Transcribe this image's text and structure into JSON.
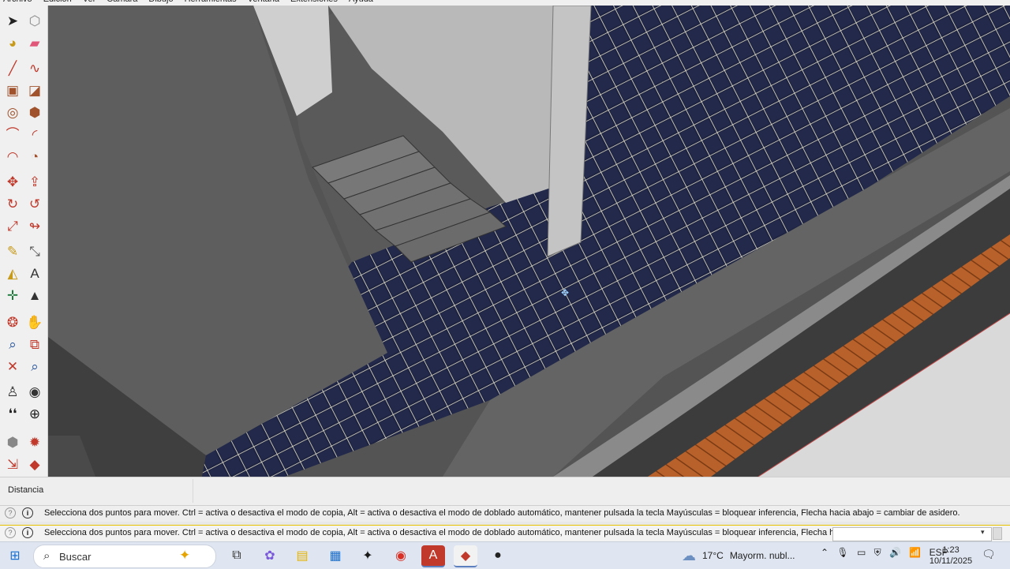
{
  "menubar": {
    "items": [
      "Archivo",
      "Edición",
      "Ver",
      "Cámara",
      "Dibujo",
      "Herramientas",
      "Ventana",
      "Extensiones",
      "Ayuda"
    ]
  },
  "toolbar": {
    "tools": [
      {
        "name": "select-tool-icon",
        "glyph": "➤",
        "color": "#222222"
      },
      {
        "name": "make-component-icon",
        "glyph": "⬡",
        "color": "#888888"
      },
      {
        "name": "paint-bucket-icon",
        "glyph": "◕",
        "color": "#c79a1a"
      },
      {
        "name": "eraser-icon",
        "glyph": "▰",
        "color": "#e0577a"
      },
      {
        "name": "line-tool-icon",
        "glyph": "╱",
        "color": "#c0392b"
      },
      {
        "name": "freehand-tool-icon",
        "glyph": "∿",
        "color": "#c0392b"
      },
      {
        "name": "rectangle-tool-icon",
        "glyph": "▣",
        "color": "#a0522d"
      },
      {
        "name": "rotated-rectangle-icon",
        "glyph": "◪",
        "color": "#a0522d"
      },
      {
        "name": "circle-tool-icon",
        "glyph": "◎",
        "color": "#a0522d"
      },
      {
        "name": "polygon-tool-icon",
        "glyph": "⬢",
        "color": "#a0522d"
      },
      {
        "name": "arc-tool-icon",
        "glyph": "⌒",
        "color": "#c0392b"
      },
      {
        "name": "two-point-arc-icon",
        "glyph": "◜",
        "color": "#c0392b"
      },
      {
        "name": "three-point-arc-icon",
        "glyph": "◠",
        "color": "#c0392b"
      },
      {
        "name": "pie-tool-icon",
        "glyph": "◔",
        "color": "#a0522d"
      },
      {
        "name": "move-tool-icon",
        "glyph": "✥",
        "color": "#c0392b"
      },
      {
        "name": "push-pull-icon",
        "glyph": "⇪",
        "color": "#c0392b"
      },
      {
        "name": "rotate-tool-icon",
        "glyph": "↻",
        "color": "#c0392b"
      },
      {
        "name": "follow-me-icon",
        "glyph": "↺",
        "color": "#c0392b"
      },
      {
        "name": "scale-tool-icon",
        "glyph": "⤢",
        "color": "#c0392b"
      },
      {
        "name": "offset-tool-icon",
        "glyph": "↬",
        "color": "#c0392b"
      },
      {
        "name": "tape-measure-icon",
        "glyph": "✎",
        "color": "#c79a1a"
      },
      {
        "name": "dimension-tool-icon",
        "glyph": "⤡",
        "color": "#555555"
      },
      {
        "name": "protractor-icon",
        "glyph": "◭",
        "color": "#c79a1a"
      },
      {
        "name": "text-tool-icon",
        "glyph": "A",
        "color": "#333333"
      },
      {
        "name": "axes-tool-icon",
        "glyph": "✛",
        "color": "#1a7a3a"
      },
      {
        "name": "3d-text-icon",
        "glyph": "▲",
        "color": "#333333"
      },
      {
        "name": "orbit-tool-icon",
        "glyph": "❂",
        "color": "#c0392b"
      },
      {
        "name": "pan-tool-icon",
        "glyph": "✋",
        "color": "#c79a1a"
      },
      {
        "name": "zoom-tool-icon",
        "glyph": "⌕",
        "color": "#1f4f9a"
      },
      {
        "name": "zoom-window-icon",
        "glyph": "⧉",
        "color": "#c0392b"
      },
      {
        "name": "zoom-extents-icon",
        "glyph": "✕",
        "color": "#c0392b"
      },
      {
        "name": "zoom-previous-icon",
        "glyph": "⌕",
        "color": "#1f4f9a"
      },
      {
        "name": "position-camera-icon",
        "glyph": "♙",
        "color": "#333333"
      },
      {
        "name": "look-around-icon",
        "glyph": "◉",
        "color": "#333333"
      },
      {
        "name": "walk-tool-icon",
        "glyph": "❛❛",
        "color": "#222222"
      },
      {
        "name": "section-plane-icon",
        "glyph": "⊕",
        "color": "#222222"
      },
      {
        "name": "warehouse-icon",
        "glyph": "⬢",
        "color": "#888888"
      },
      {
        "name": "extension-warehouse-icon",
        "glyph": "✹",
        "color": "#c0392b"
      },
      {
        "name": "send-to-layout-icon",
        "glyph": "⇲",
        "color": "#c0392b"
      },
      {
        "name": "ruby-console-icon",
        "glyph": "◆",
        "color": "#c0392b"
      }
    ]
  },
  "measurements": {
    "label": "Distancia",
    "value": ""
  },
  "status": {
    "top_message": "Selecciona dos puntos para mover. Ctrl = activa o desactiva el modo de copia, Alt = activa o desactiva el modo de doblado automático, mantener pulsada la tecla Mayúsculas = bloquear inferencia, Flecha hacia abajo = cambiar de asidero.",
    "bottom_message": "Selecciona dos puntos para mover. Ctrl = activa o desactiva el modo de copia, Alt = activa o desactiva el modo de doblado automático, mantener pulsada la tecla Mayúsculas = bloquear inferencia, Flecha hacia abajo =",
    "help_glyph": "?",
    "info_glyph": "i",
    "vcb_value": ""
  },
  "taskbar": {
    "search_placeholder": "Buscar",
    "weather_temp": "17°C",
    "weather_text": "Mayorm. nubl...",
    "language": "ESP",
    "time": "1:23",
    "date": "10/11/2025",
    "apps": [
      {
        "name": "windows-start-icon",
        "glyph": "⊞",
        "color": "#1a6fd0"
      },
      {
        "name": "task-view-icon",
        "glyph": "⧉",
        "color": "#333333"
      },
      {
        "name": "copilot-icon",
        "glyph": "✿",
        "color": "#7a5ad8"
      },
      {
        "name": "file-explorer-icon",
        "glyph": "▤",
        "color": "#e8b400"
      },
      {
        "name": "microsoft-store-icon",
        "glyph": "▦",
        "color": "#1a6fd0"
      },
      {
        "name": "dropbox-icon",
        "glyph": "✦",
        "color": "#1a1a1a"
      },
      {
        "name": "chrome-icon",
        "glyph": "◉",
        "color": "#d93025"
      },
      {
        "name": "autocad-icon",
        "glyph": "A",
        "color": "#ffffff"
      },
      {
        "name": "sketchup-icon",
        "glyph": "◆",
        "color": "#c0392b"
      },
      {
        "name": "obs-icon",
        "glyph": "●",
        "color": "#222222"
      }
    ]
  },
  "viewport": {
    "tile_color": "#1d2340",
    "grout_color": "#e8e4cf",
    "wall_color": "#6a6a6a",
    "wood_color": "#b8612a"
  }
}
